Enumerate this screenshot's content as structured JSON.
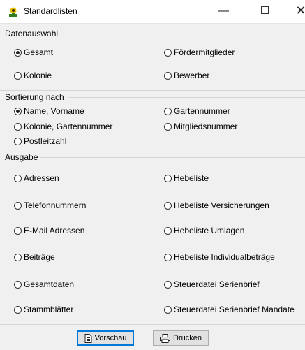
{
  "window": {
    "title": "Standardlisten",
    "minimize_glyph": "—",
    "close_glyph": "✕"
  },
  "datenauswahl": {
    "label": "Datenauswahl",
    "options": {
      "gesamt": "Gesamt",
      "foerdermitglieder": "Fördermitglieder",
      "kolonie": "Kolonie",
      "bewerber": "Bewerber"
    },
    "selected": "Gesamt"
  },
  "sortierung": {
    "label": "Sortierung nach",
    "options": {
      "name": "Name, Vorname",
      "gartennummer": "Gartennummer",
      "kolonie_garten": "Kolonie, Gartennummer",
      "mitgliedsnummer": "Mitgliedsnummer",
      "postleitzahl": "Postleitzahl"
    },
    "selected": "Name, Vorname"
  },
  "ausgabe": {
    "label": "Ausgabe",
    "options": {
      "adressen": "Adressen",
      "hebeliste": "Hebeliste",
      "telefonnummern": "Telefonnummern",
      "hebeliste_versicherungen": "Hebeliste Versicherungen",
      "email": "E-Mail Adressen",
      "hebeliste_umlagen": "Hebeliste Umlagen",
      "beitraege": "Beiträge",
      "hebeliste_individual": "Hebeliste Individualbeträge",
      "gesamtdaten": "Gesamtdaten",
      "steuerdatei": "Steuerdatei Serienbrief",
      "stammblaetter": "Stammblätter",
      "steuerdatei_mandate": "Steuerdatei Serienbrief Mandate"
    }
  },
  "buttons": {
    "preview": "Vorschau",
    "print": "Drucken"
  },
  "icons": {
    "app": "app-icon",
    "preview": "document-icon",
    "print": "printer-icon"
  },
  "colors": {
    "window_bg": "#f0f0f0",
    "titlebar_bg": "#ffffff",
    "default_button_border": "#0078d7"
  }
}
